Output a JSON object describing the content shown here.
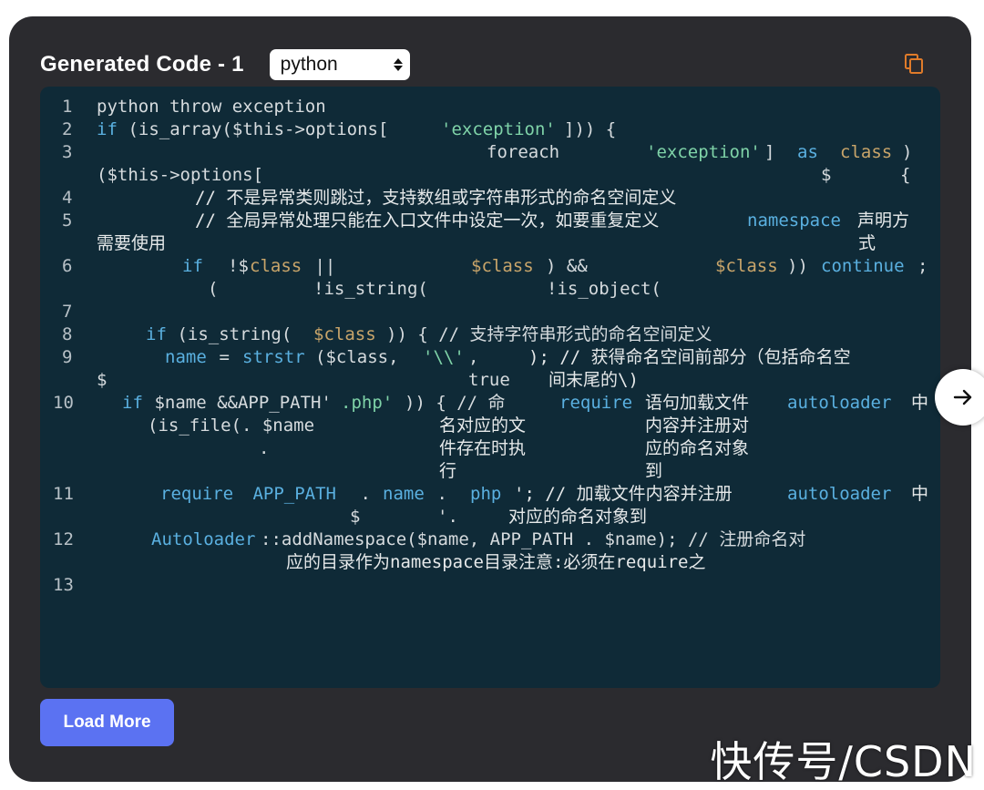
{
  "header": {
    "title": "Generated Code - 1",
    "language_selected": "python"
  },
  "icons": {
    "copy": "copy-icon",
    "next": "arrow-right-icon"
  },
  "colors": {
    "panel_bg": "#2b2b2f",
    "code_bg": "#0f2a37",
    "keyword": "#5ab0e0",
    "string": "#7fd3a8",
    "variable": "#c9a56a",
    "button": "#5b72f2",
    "copy_icon": "#e07b2a"
  },
  "code": {
    "line_numbers": [
      "1",
      "2",
      "3",
      "4",
      "5",
      "6",
      "7",
      "8",
      "9",
      "10",
      "11",
      "12",
      "13"
    ],
    "t1": "python throw exception",
    "t2a": "if",
    "t2b": " (is_array($this->options[",
    "t2c": "'exception'",
    "t2d": "])) {",
    "t3a": "foreach",
    "t3b": "'exception'",
    "t3c": "] ",
    "t3d": "as",
    "t3e": "class",
    "t3f": ")",
    "t3g": "($this->options[",
    "t3h": "$",
    "t3i": "{",
    "t4": "// 不是异常类则跳过，支持数组或字符串形式的命名空间定义",
    "t5a": "// 全局异常处理只能在入口文件中设定一次，如要重复定义",
    "t5b": "namespace",
    "t5c": "声明方",
    "t5d": "需要使用",
    "t5e": "式",
    "t6a": "if",
    "t6b": "!$",
    "t6c": "class",
    "t6d": " ||",
    "t6e": "$class",
    "t6f": ") &&",
    "t6g": "$class",
    "t6h": "))",
    "t6i": "continue",
    "t6j": ";",
    "t6k": "(",
    "t6l": "!is_string(",
    "t6m": "!is_object(",
    "t8a": "if",
    "t8b": " (is_string(",
    "t8c": "$class",
    "t8d": ")) { // 支持字符串形式的命名空间定义",
    "t9a": "name",
    "t9b": " = ",
    "t9c": "strstr",
    "t9d": "($class, ",
    "t9e": "'\\\\'",
    "t9f": ",",
    "t9g": "); // 获得命名空间前部分（包括命名空",
    "t9h": "$",
    "t9i": "true",
    "t9j": "间末尾的\\)",
    "t10a": "if",
    "t10b": " $name &&APP_PATH'",
    "t10c": ".php'",
    "t10d": ")) { // 命",
    "t10e": "require",
    "t10f": "语句加载文件",
    "t10g": "autoloader",
    "t10h": "中",
    "t10i": "(is_file(. $name",
    "t10j": "名对应的文",
    "t10k": "内容并注册对",
    "t10l": ".",
    "t10m": "件存在时执",
    "t10n": "应的命名对象",
    "t10o": "行",
    "t10p": "到",
    "t11a": "require",
    "t11b": " APP_PATH",
    "t11c": " . ",
    "t11d": "name",
    "t11e": " . ",
    "t11f": "php",
    "t11g": "'; // 加载文件内容并注册",
    "t11h": "autoloader",
    "t11i": "中",
    "t11j": "$",
    "t11k": "'.",
    "t11l": "对应的命名对象到",
    "t12a": "Autoloader",
    "t12b": "::addNamespace($name, APP_PATH . $name); // 注册命名对",
    "t12c": "应的目录作为namespace目录注意:必须在require之"
  },
  "footer": {
    "load_more_label": "Load More"
  },
  "watermark": "快传号/CSDN"
}
